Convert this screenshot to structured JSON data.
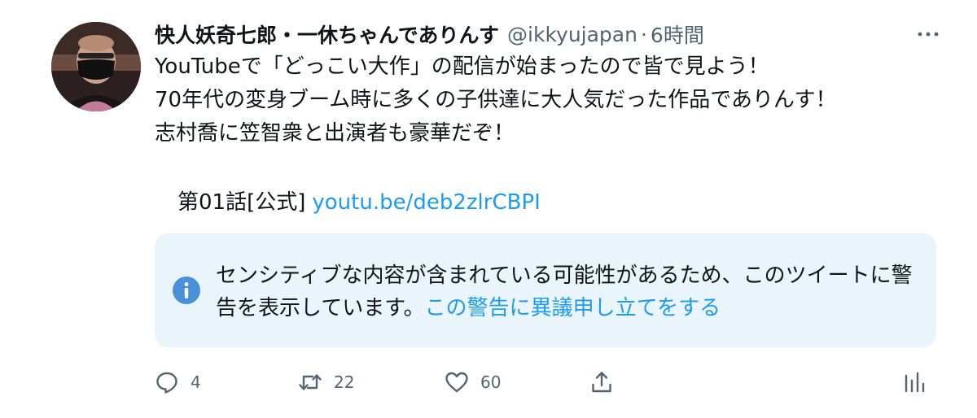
{
  "author": {
    "display_name": "快人妖奇七郎・一休ちゃんでありんす",
    "handle": "@ikkyujapan",
    "separator": "·",
    "time": "6時間"
  },
  "tweet": {
    "lines": [
      "YouTubeで「どっこい大作」の配信が始まったので皆で見よう！",
      "70年代の変身ブーム時に多くの子供達に大人気だった作品でありんす！",
      "志村喬に笠智衆と出演者も豪華だぞ！"
    ],
    "link_prefix": "第01話[公式]",
    "link_text": "youtu.be/deb2zlrCBPI"
  },
  "warning": {
    "message": "センシティブな内容が含まれている可能性があるため、このツイートに警告を表示しています。",
    "appeal_link": "この警告に異議申し立てをする"
  },
  "actions": {
    "reply_count": "4",
    "retweet_count": "22",
    "like_count": "60"
  },
  "icons": {
    "more": "more-horizontal-icon",
    "info": "info-icon",
    "reply": "reply-icon",
    "retweet": "retweet-icon",
    "like": "heart-icon",
    "share": "share-icon",
    "analytics": "analytics-icon"
  },
  "colors": {
    "link": "#1d9bf0",
    "secondary_text": "#536471",
    "warning_bg": "#eaf4fb",
    "info_icon": "#4a90d9"
  }
}
